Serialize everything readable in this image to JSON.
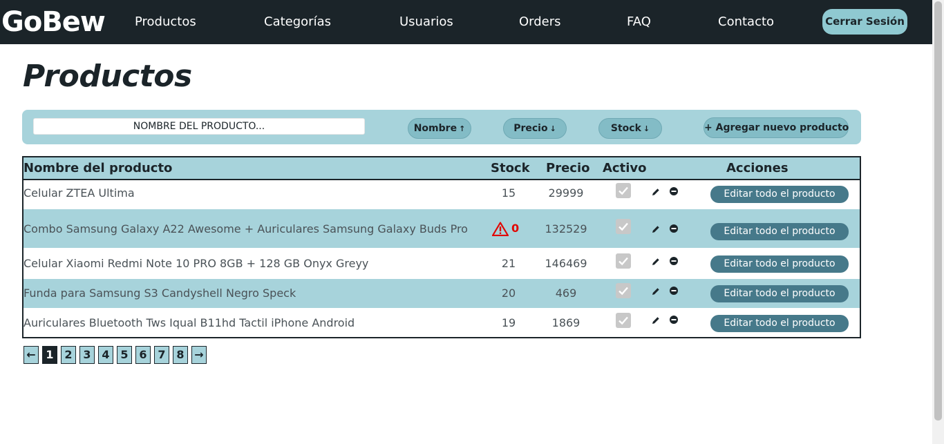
{
  "brand": {
    "logo": "GoBew"
  },
  "nav": {
    "items": [
      {
        "label": "Productos"
      },
      {
        "label": "Categorías"
      },
      {
        "label": "Usuarios"
      },
      {
        "label": "Orders"
      },
      {
        "label": "FAQ"
      },
      {
        "label": "Contacto"
      }
    ],
    "logout_label": "Cerrar Sesión"
  },
  "page": {
    "title": "Productos"
  },
  "toolbar": {
    "search_placeholder": "NOMBRE DEL PRODUCTO...",
    "search_value": "",
    "sort_name_label": "Nombre",
    "sort_name_arrow": "↑",
    "sort_price_label": "Precio",
    "sort_price_arrow": "↓",
    "sort_stock_label": "Stock",
    "sort_stock_arrow": "↓",
    "add_label": "+ Agregar nuevo producto"
  },
  "table": {
    "headers": {
      "name": "Nombre del producto",
      "stock": "Stock",
      "price": "Precio",
      "active": "Activo",
      "actions": "Acciones"
    },
    "rows": [
      {
        "name": "Celular ZTEA Ultima",
        "stock": "15",
        "price": "29999",
        "active": true,
        "action_label": "Editar todo el producto"
      },
      {
        "name": "Combo Samsung Galaxy A22 Awesome + Auriculares Samsung Galaxy Buds Pro",
        "stock": "0",
        "price": "132529",
        "active": true,
        "action_label": "Editar todo el producto"
      },
      {
        "name": "Celular Xiaomi Redmi Note 10 PRO 8GB + 128 GB Onyx Greyy",
        "stock": "21",
        "price": "146469",
        "active": true,
        "action_label": "Editar todo el producto"
      },
      {
        "name": "Funda para Samsung S3 Candyshell Negro Speck",
        "stock": "20",
        "price": "469",
        "active": true,
        "action_label": "Editar todo el producto"
      },
      {
        "name": "Auriculares Bluetooth Tws Iqual B11hd Tactil iPhone Android",
        "stock": "19",
        "price": "1869",
        "active": true,
        "action_label": "Editar todo el producto"
      }
    ]
  },
  "pagination": {
    "prev": "←",
    "next": "→",
    "pages": [
      "1",
      "2",
      "3",
      "4",
      "5",
      "6",
      "7",
      "8"
    ],
    "current": "1"
  },
  "colors": {
    "nav_bg": "#1b2429",
    "accent_light": "#a7d3db",
    "button_dark": "#46798a",
    "warning": "#e10600"
  },
  "icons": [
    "pencil-icon",
    "minus-circle-icon",
    "warning-icon",
    "checkmark-icon"
  ]
}
